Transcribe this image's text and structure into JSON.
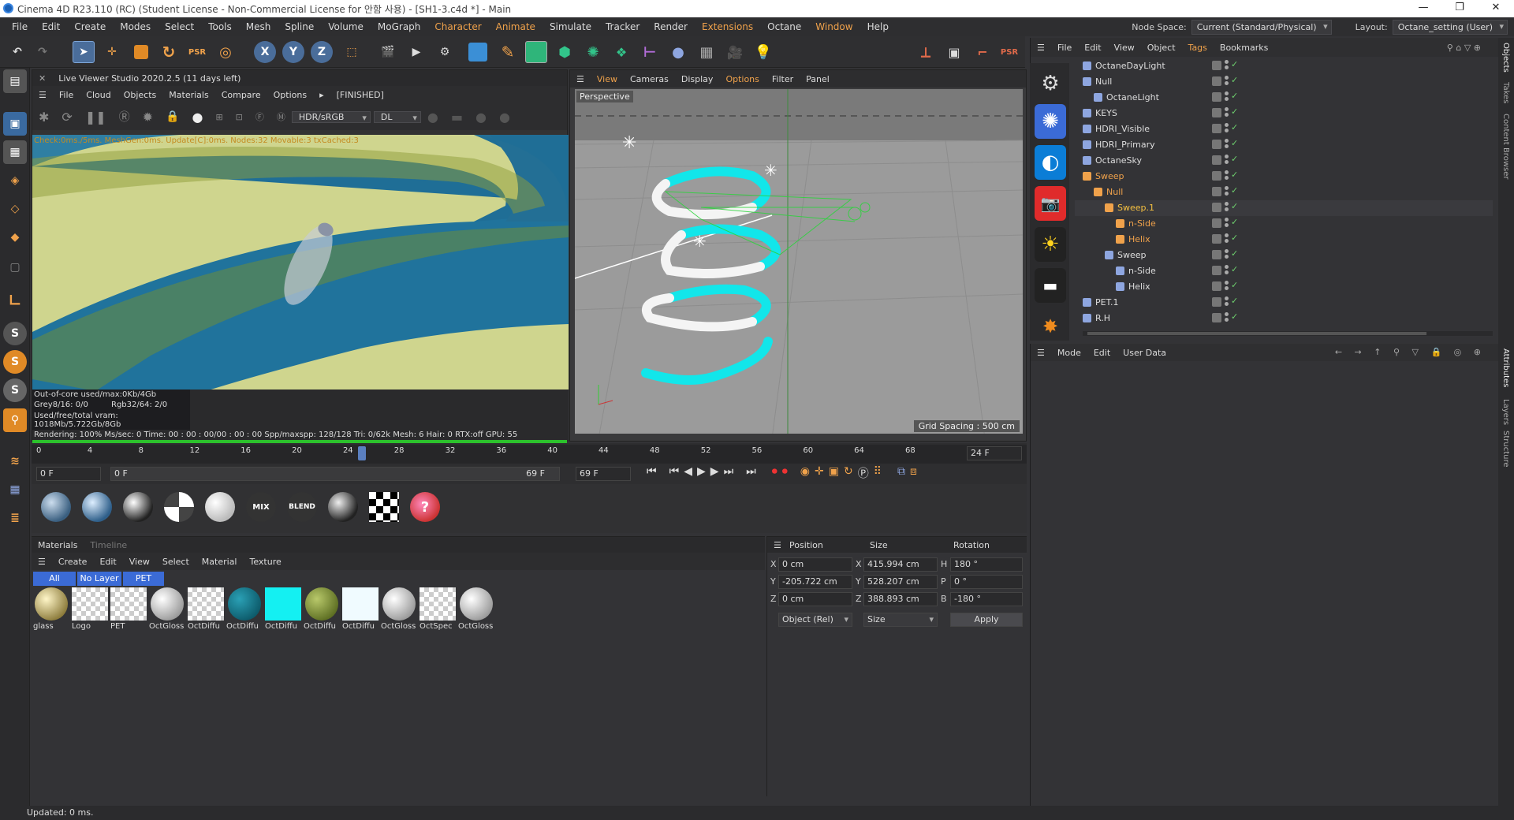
{
  "window": {
    "title": "Cinema 4D R23.110 (RC) (Student License - Non-Commercial License for 안함 사용) - [SH1-3.c4d *] - Main",
    "controls": [
      "—",
      "❐",
      "✕"
    ]
  },
  "menu": {
    "items": [
      "File",
      "Edit",
      "Create",
      "Modes",
      "Select",
      "Tools",
      "Mesh",
      "Spline",
      "Volume",
      "MoGraph",
      "Character",
      "Animate",
      "Simulate",
      "Tracker",
      "Render",
      "Extensions",
      "Octane",
      "Window",
      "Help"
    ],
    "node_space_label": "Node Space:",
    "node_space_value": "Current (Standard/Physical)",
    "layout_label": "Layout:",
    "layout_value": "Octane_setting (User)"
  },
  "live_viewer": {
    "title": "Live Viewer Studio 2020.2.5 (11 days left)",
    "menu": [
      "File",
      "Cloud",
      "Objects",
      "Materials",
      "Compare",
      "Options"
    ],
    "status": "[FINISHED]",
    "color_mode": "HDR/sRGB",
    "kernel": "DL",
    "check_line": "Check:0ms./5ms. MeshGen:0ms. Update[C]:0ms. Nodes:32 Movable:3 txCached:3",
    "stats": {
      "ooc": "Out-of-core used/max:0Kb/4Gb",
      "grey": "Grey8/16: 0/0",
      "rgb": "Rgb32/64: 2/0",
      "vram": "Used/free/total vram: 1018Mb/5.722Gb/8Gb",
      "rendering": "Rendering: 100% Ms/sec: 0   Time: 00 : 00 : 00/00 : 00 : 00    Spp/maxspp: 128/128   Tri: 0/62k   Mesh: 6  Hair: 0   RTX:off    GPU:    55"
    }
  },
  "viewport": {
    "menu": [
      "View",
      "Cameras",
      "Display",
      "Options",
      "Filter",
      "Panel"
    ],
    "label": "Perspective",
    "grid_spacing": "Grid Spacing : 500 cm"
  },
  "timeline": {
    "ticks": [
      "0",
      "4",
      "8",
      "12",
      "16",
      "20",
      "24",
      "28",
      "32",
      "36",
      "40",
      "44",
      "48",
      "52",
      "56",
      "60",
      "64",
      "68"
    ],
    "current_frame": "24 F",
    "start_field": "0 F",
    "range_start": "0 F",
    "range_end": "69 F",
    "end_field": "69 F",
    "current_fraction": 0.35
  },
  "materials_panel": {
    "tabs": [
      "Materials",
      "Timeline"
    ],
    "menu": [
      "Create",
      "Edit",
      "View",
      "Select",
      "Material",
      "Texture"
    ],
    "filters": [
      "All",
      "No Layer",
      "PET"
    ],
    "items": [
      {
        "label": "glass",
        "kind": "glass"
      },
      {
        "label": "Logo",
        "kind": "checker"
      },
      {
        "label": "PET",
        "kind": "checker"
      },
      {
        "label": "OctGloss",
        "kind": "white"
      },
      {
        "label": "OctDiffu",
        "kind": "checker"
      },
      {
        "label": "OctDiffu",
        "kind": "teal"
      },
      {
        "label": "OctDiffu",
        "kind": "cyan"
      },
      {
        "label": "OctDiffu",
        "kind": "olive"
      },
      {
        "label": "OctDiffu",
        "kind": "paleblue"
      },
      {
        "label": "OctGloss",
        "kind": "white"
      },
      {
        "label": "OctSpec",
        "kind": "checker"
      },
      {
        "label": "OctGloss",
        "kind": "white"
      }
    ]
  },
  "mat_presets": [
    "MIX",
    "BLEND"
  ],
  "coords": {
    "headers": [
      "Position",
      "Size",
      "Rotation"
    ],
    "rows": [
      {
        "axis": "X",
        "pos": "0 cm",
        "size_axis": "X",
        "size": "415.994 cm",
        "rot_axis": "H",
        "rot": "180 °"
      },
      {
        "axis": "Y",
        "pos": "-205.722 cm",
        "size_axis": "Y",
        "size": "528.207 cm",
        "rot_axis": "P",
        "rot": "0 °"
      },
      {
        "axis": "Z",
        "pos": "0 cm",
        "size_axis": "Z",
        "size": "388.893 cm",
        "rot_axis": "B",
        "rot": "-180 °"
      }
    ],
    "mode": "Object (Rel)",
    "size_mode": "Size",
    "apply": "Apply"
  },
  "objects_panel": {
    "menu": [
      "File",
      "Edit",
      "View",
      "Object",
      "Tags",
      "Bookmarks"
    ],
    "rows": [
      {
        "name": "OctaneDayLight",
        "indent": 0,
        "color": "#dddddd"
      },
      {
        "name": "Null",
        "indent": 0,
        "color": "#dddddd"
      },
      {
        "name": "OctaneLight",
        "indent": 1,
        "color": "#dddddd"
      },
      {
        "name": "KEYS",
        "indent": 0,
        "color": "#dddddd"
      },
      {
        "name": "HDRI_Visible",
        "indent": 0,
        "color": "#dddddd"
      },
      {
        "name": "HDRI_Primary",
        "indent": 0,
        "color": "#dddddd"
      },
      {
        "name": "OctaneSky",
        "indent": 0,
        "color": "#dddddd"
      },
      {
        "name": "Sweep",
        "indent": 0,
        "color": "#f0a24b"
      },
      {
        "name": "Null",
        "indent": 1,
        "color": "#f0a24b"
      },
      {
        "name": "Sweep.1",
        "indent": 2,
        "color": "#f5c040"
      },
      {
        "name": "n-Side",
        "indent": 3,
        "color": "#f0a24b"
      },
      {
        "name": "Helix",
        "indent": 3,
        "color": "#f0a24b"
      },
      {
        "name": "Sweep",
        "indent": 2,
        "color": "#dddddd"
      },
      {
        "name": "n-Side",
        "indent": 3,
        "color": "#dddddd"
      },
      {
        "name": "Helix",
        "indent": 3,
        "color": "#dddddd"
      },
      {
        "name": "PET.1",
        "indent": 0,
        "color": "#dddddd"
      },
      {
        "name": "R.H",
        "indent": 0,
        "color": "#dddddd"
      }
    ]
  },
  "attributes": {
    "menu": [
      "Mode",
      "Edit",
      "User Data"
    ]
  },
  "side_tabs": [
    "Objects",
    "Takes",
    "Content Browser",
    "Attributes",
    "Layers",
    "Structure"
  ],
  "statusbar": "Updated: 0 ms."
}
